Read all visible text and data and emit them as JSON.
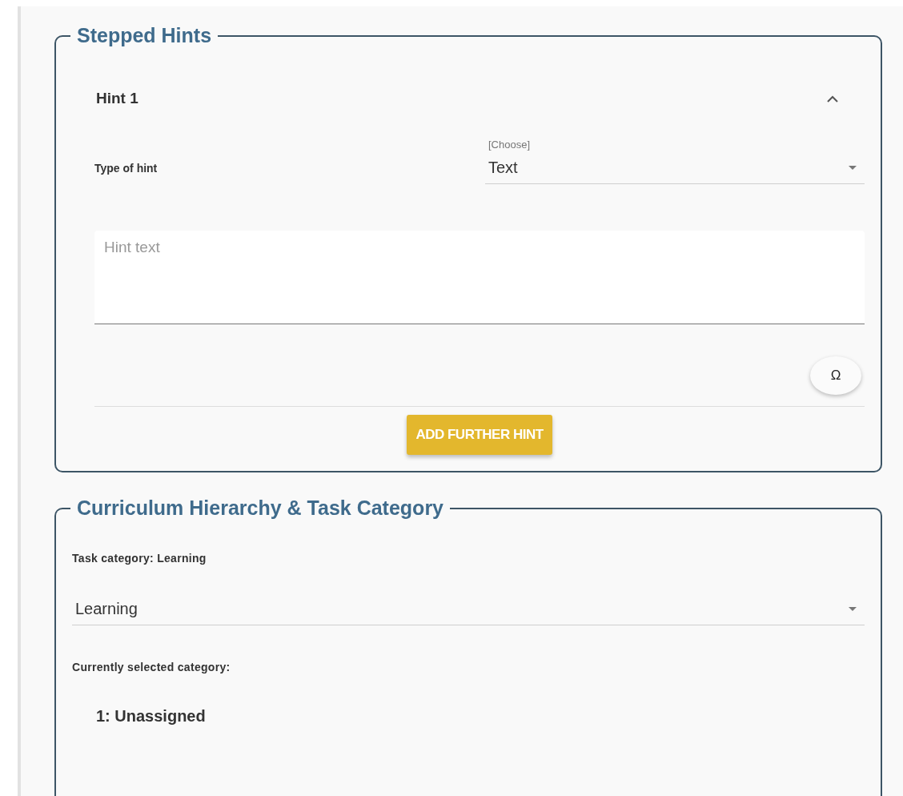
{
  "stepped_hints": {
    "title": "Stepped Hints",
    "hints": [
      {
        "title": "Hint 1",
        "expanded": true,
        "type_label": "Type of hint",
        "type_select": {
          "label": "[Choose]",
          "value": "Text"
        },
        "hint_text": {
          "placeholder": "Hint text"
        },
        "special_char_button": "Ω"
      }
    ],
    "add_button": "ADD FURTHER HINT"
  },
  "curriculum": {
    "title": "Curriculum Hierarchy & Task Category",
    "category_label": "Task category: Learning",
    "category_select": {
      "value": "Learning"
    },
    "selected_label": "Currently selected category:",
    "selected_value": "1: Unassigned"
  }
}
